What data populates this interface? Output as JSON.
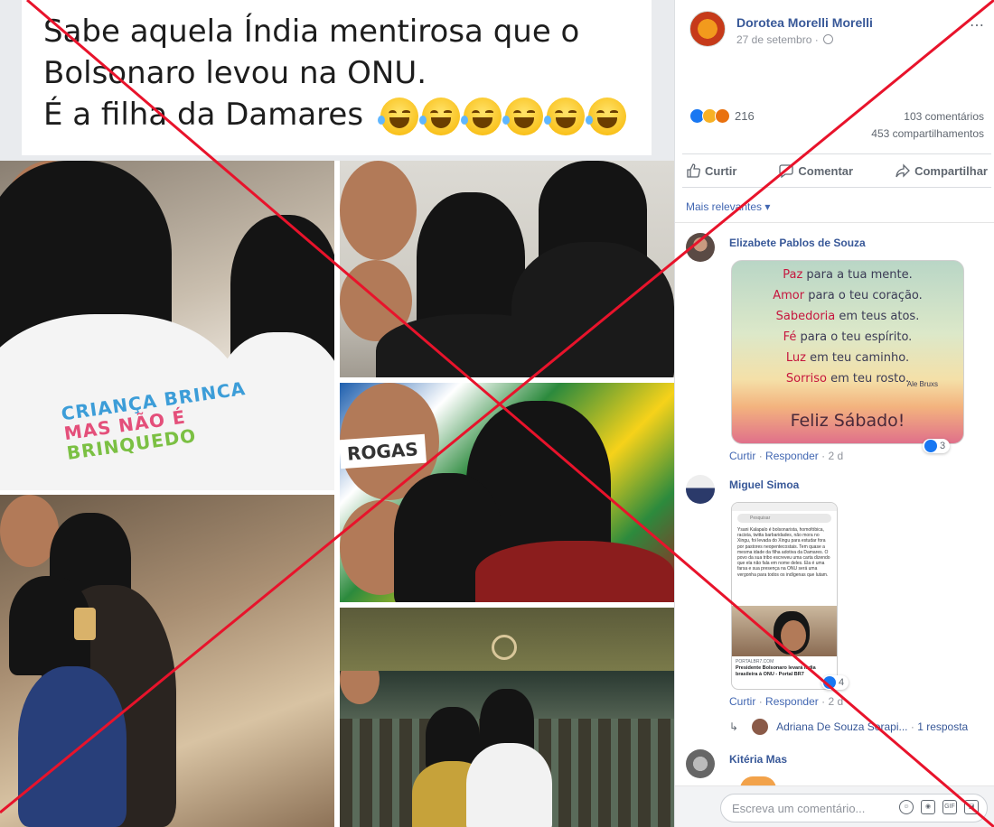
{
  "caption": {
    "line1": "Sabe aquela Índia mentirosa que o",
    "line2": "Bolsonaro levou na ONU.",
    "line3": "É a filha da Damares",
    "emoji_count": 6,
    "emoji_name": "tears-of-joy-emoji"
  },
  "collage": {
    "shirt_line1": "CRIANÇA BRINCA",
    "shirt_line2": "MAS NÃO É",
    "shirt_line3": "BRINQUEDO",
    "banner": "ROGAS"
  },
  "post": {
    "author": "Dorotea Morelli Morelli",
    "date": "27 de setembro ·",
    "reaction_count": "216",
    "comments": "103 comentários",
    "shares": "453 compartilhamentos"
  },
  "actions": {
    "like": "Curtir",
    "comment": "Comentar",
    "share": "Compartilhar"
  },
  "sort_label": "Mais relevantes ▾",
  "comments": [
    {
      "name": "Elizabete Pablos de Souza",
      "card": {
        "l1a": "Paz",
        "l1b": " para a tua mente.",
        "l2a": "Amor",
        "l2b": " para o teu coração.",
        "l3a": "Sabedoria",
        "l3b": " em teus atos.",
        "l4a": "Fé",
        "l4b": " para o teu espírito.",
        "l5a": "Luz",
        "l5b": " em teu caminho.",
        "l6a": "Sorriso",
        "l6b": " em teu rosto.",
        "sign": "Ale Bruxs",
        "footer": "Feliz Sábado!"
      },
      "like": "Curtir",
      "reply": "Responder",
      "time": "2 d",
      "reactions": "3"
    },
    {
      "name": "Miguel Simoa",
      "phone": {
        "search": "Pesquisar",
        "text": "Ysani Kalapalo é bolsonarista, homofóbica, racista, twitta barbaridades, não mora no Xingu, foi levada do Xingu para estudar fora por pastores neopentecostais. Tem quase a mesma idade da filha adotiva da Damares. O povo da sua tribo escreveu uma carta dizendo que ela não fala em nome deles. Ela é uma farsa e sua presença na ONU será uma vergonha para todos os indígenas que lutam.",
        "caption": "Presidente Bolsonaro levará índia brasileira à ONU - Portal BR7",
        "url": "PORTALBR7.COM"
      },
      "like": "Curtir",
      "reply": "Responder",
      "time": "2 d",
      "reactions": "4"
    },
    {
      "name": "Kitéria Mas"
    }
  ],
  "reply_thread": {
    "name": "Adriana De Souza Serapi...",
    "count": "1 resposta"
  },
  "composer": {
    "placeholder": "Escreva um comentário..."
  },
  "colors": {
    "link": "#385898",
    "x_red": "#e8132b"
  }
}
